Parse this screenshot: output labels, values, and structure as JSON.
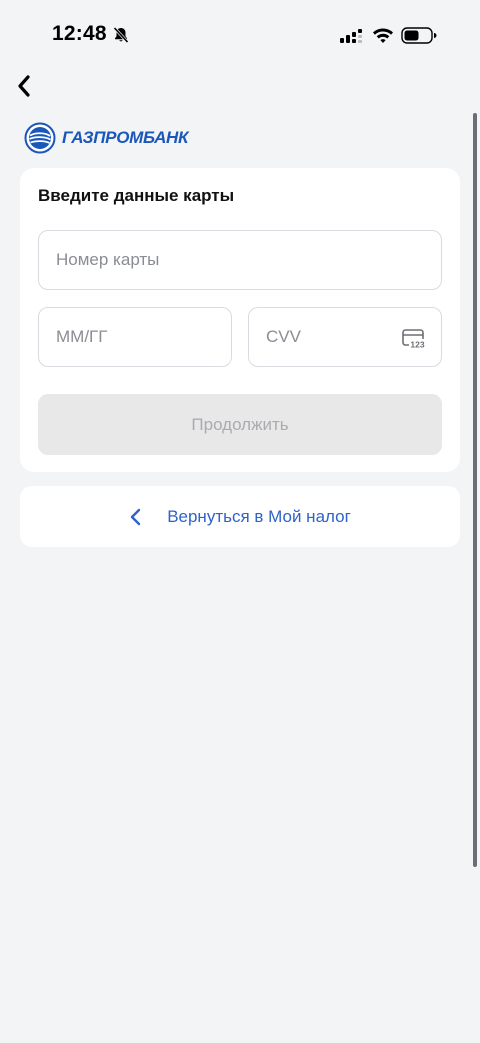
{
  "status_bar": {
    "time": "12:48",
    "icons": [
      "bell-slash-icon",
      "signal-icon",
      "wifi-icon",
      "battery-icon"
    ]
  },
  "nav": {
    "back_icon": "chevron-left-icon"
  },
  "logo": {
    "text": "ГАЗПРОМБАНК",
    "color": "#1a57b8"
  },
  "card": {
    "title": "Введите данные карты",
    "card_number": {
      "placeholder": "Номер карты",
      "value": ""
    },
    "expiry": {
      "placeholder": "ММ/ГГ",
      "value": ""
    },
    "cvv": {
      "placeholder": "CVV",
      "value": "",
      "icon": "card-cvv-icon"
    },
    "continue_label": "Продолжить",
    "continue_enabled": false
  },
  "return_link": {
    "label": "Вернуться в Мой налог",
    "icon": "chevron-left-icon",
    "color": "#2e63c9"
  }
}
